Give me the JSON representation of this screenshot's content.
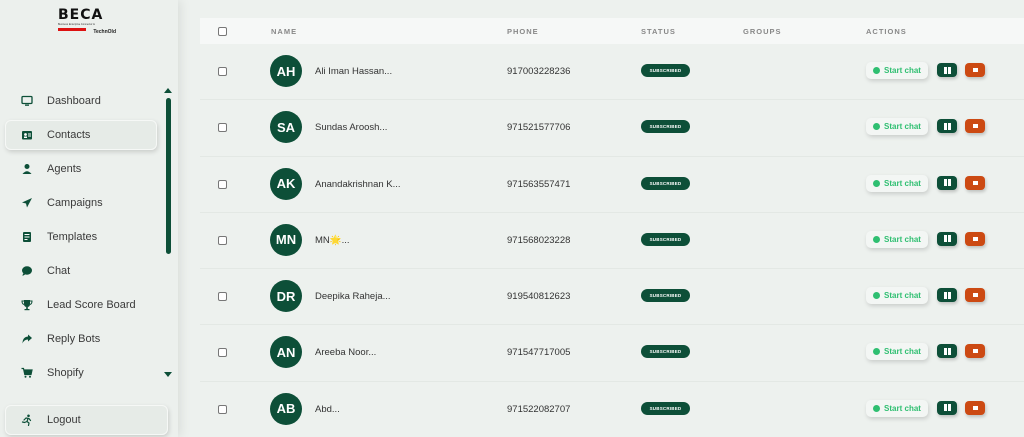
{
  "brand": {
    "logo_text": "BECA",
    "logo_subtext": "Business Enterprise Connector &",
    "logo_tag": "TechnOld"
  },
  "nav": {
    "items": [
      {
        "label": "Dashboard",
        "icon": "monitor-icon",
        "active": false
      },
      {
        "label": "Contacts",
        "icon": "contacts-icon",
        "active": true
      },
      {
        "label": "Agents",
        "icon": "user-icon",
        "active": false
      },
      {
        "label": "Campaigns",
        "icon": "paper-plane-icon",
        "active": false
      },
      {
        "label": "Templates",
        "icon": "document-icon",
        "active": false
      },
      {
        "label": "Chat",
        "icon": "chat-bubble-icon",
        "active": false
      },
      {
        "label": "Lead Score Board",
        "icon": "trophy-icon",
        "active": false
      },
      {
        "label": "Reply Bots",
        "icon": "reply-arrow-icon",
        "active": false
      },
      {
        "label": "Shopify",
        "icon": "cart-icon",
        "active": false
      }
    ],
    "logout_label": "Logout"
  },
  "table": {
    "headers": {
      "name": "NAME",
      "phone": "PHONE",
      "status": "STATUS",
      "groups": "GROUPS",
      "actions": "ACTIONS"
    },
    "start_chat_label": "Start chat",
    "rows": [
      {
        "initials": "AH",
        "name": "Ali Iman Hassan...",
        "phone": "917003228236",
        "status": "SUBSCRIBED"
      },
      {
        "initials": "SA",
        "name": "Sundas Aroosh...",
        "phone": "971521577706",
        "status": "SUBSCRIBED"
      },
      {
        "initials": "AK",
        "name": "Anandakrishnan K...",
        "phone": "971563557471",
        "status": "SUBSCRIBED"
      },
      {
        "initials": "MN",
        "name": "MN🌟...",
        "phone": "971568023228",
        "status": "SUBSCRIBED"
      },
      {
        "initials": "DR",
        "name": "Deepika Raheja...",
        "phone": "919540812623",
        "status": "SUBSCRIBED"
      },
      {
        "initials": "AN",
        "name": "Areeba Noor...",
        "phone": "971547717005",
        "status": "SUBSCRIBED"
      },
      {
        "initials": "AB",
        "name": "Abd...",
        "phone": "971522082707",
        "status": "SUBSCRIBED"
      }
    ]
  },
  "colors": {
    "primary": "#0d4f38",
    "accent_green": "#2fbf71",
    "danger": "#cc4a13",
    "background": "#edf1ee"
  }
}
